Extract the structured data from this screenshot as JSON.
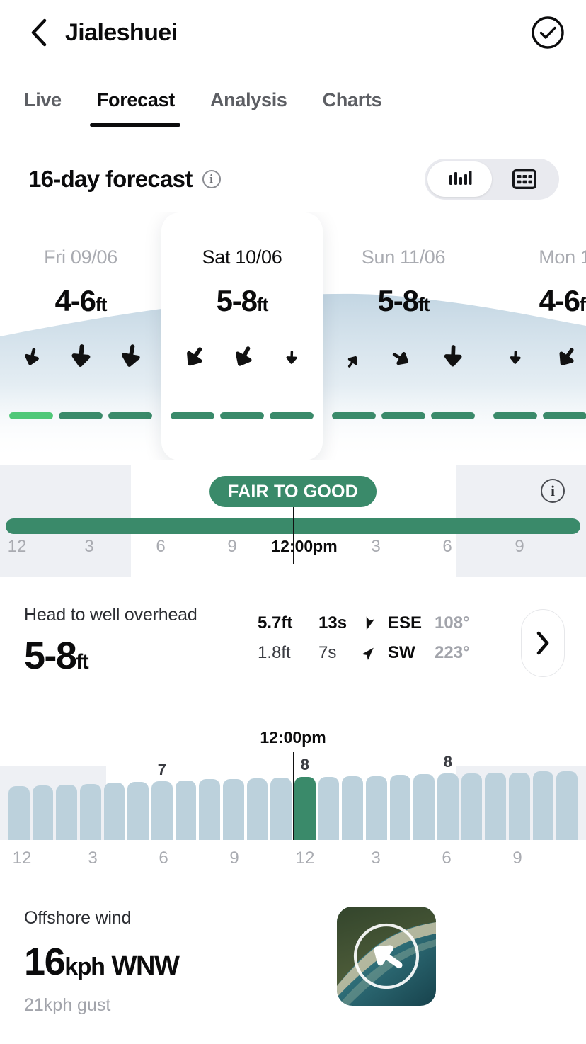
{
  "header": {
    "title": "Jialeshuei",
    "back_icon": "chevron-left-icon",
    "check_icon": "check-circle-icon"
  },
  "tabs": [
    {
      "label": "Live",
      "active": false
    },
    {
      "label": "Forecast",
      "active": true
    },
    {
      "label": "Analysis",
      "active": false
    },
    {
      "label": "Charts",
      "active": false
    }
  ],
  "forecast": {
    "title": "16-day forecast",
    "info_icon": "info-icon",
    "view_toggle": {
      "chart_option_icon": "bar-chart-icon",
      "table_option_icon": "grid-table-icon",
      "selected": "chart"
    }
  },
  "days": [
    {
      "name": "Fri 09/06",
      "height": "4-6",
      "unit": "ft",
      "selected": false,
      "winds": [
        {
          "angle": 105,
          "scale": 0.78
        },
        {
          "angle": 95,
          "scale": 1.0
        },
        {
          "angle": 100,
          "scale": 1.0
        }
      ],
      "ratings": [
        "#4fc878",
        "#3a8a6a",
        "#3a8a6a"
      ]
    },
    {
      "name": "Sat 10/06",
      "height": "5-8",
      "unit": "ft",
      "selected": true,
      "winds": [
        {
          "angle": 125,
          "scale": 0.95
        },
        {
          "angle": 118,
          "scale": 0.95
        },
        {
          "angle": 92,
          "scale": 0.58
        }
      ],
      "ratings": [
        "#3a8a6a",
        "#3a8a6a",
        "#3a8a6a"
      ]
    },
    {
      "name": "Sun 11/06",
      "height": "5-8",
      "unit": "ft",
      "selected": false,
      "winds": [
        {
          "angle": 305,
          "scale": 0.58
        },
        {
          "angle": 30,
          "scale": 0.78
        },
        {
          "angle": 92,
          "scale": 0.95
        }
      ],
      "ratings": [
        "#3a8a6a",
        "#3a8a6a",
        "#3a8a6a"
      ]
    },
    {
      "name": "Mon 1",
      "height": "4-6",
      "unit": "ft",
      "selected": false,
      "winds": [
        {
          "angle": 92,
          "scale": 0.58
        },
        {
          "angle": 125,
          "scale": 0.9
        },
        {
          "angle": 110,
          "scale": 0.8
        }
      ],
      "ratings": [
        "#3a8a6a",
        "#3a8a6a",
        "#3a8a6a"
      ]
    }
  ],
  "rating_timeline": {
    "label": "FAIR TO GOOD",
    "color": "#3a8a6a",
    "info_icon": "info-icon",
    "now_label": "12:00pm",
    "ticks": [
      "12",
      "3",
      "6",
      "9",
      "12:00pm",
      "3",
      "6",
      "9"
    ],
    "now_tick_index": 4
  },
  "swell": {
    "description": "Head to well overhead",
    "size": "5-8",
    "unit": "ft",
    "primary": {
      "height": "5.7ft",
      "period": "13s",
      "direction": "ESE",
      "degrees": "108°",
      "arrow_icon": "swell-direction-arrow-icon",
      "arrow_angle": 198
    },
    "secondary": {
      "height": "1.8ft",
      "period": "7s",
      "direction": "SW",
      "degrees": "223°",
      "arrow_icon": "swell-direction-arrow-icon",
      "arrow_angle": 43
    },
    "expand_icon": "chevron-right-icon"
  },
  "chart_data": {
    "type": "bar",
    "title": "",
    "xlabel": "",
    "ylabel": "",
    "now_label": "12:00pm",
    "now_index": 12,
    "grid": false,
    "legend": false,
    "x": [
      "0",
      "1",
      "2",
      "3",
      "4",
      "5",
      "6",
      "7",
      "8",
      "9",
      "10",
      "11",
      "12",
      "13",
      "14",
      "15",
      "16",
      "17",
      "18",
      "19",
      "20",
      "21",
      "22",
      "23"
    ],
    "values": [
      6.2,
      6.3,
      6.4,
      6.5,
      6.6,
      6.7,
      6.8,
      6.9,
      7.0,
      7.0,
      7.1,
      7.2,
      7.3,
      7.3,
      7.4,
      7.4,
      7.5,
      7.6,
      7.7,
      7.7,
      7.8,
      7.8,
      7.9,
      7.9
    ],
    "ylim": [
      0,
      9
    ],
    "point_labels": [
      {
        "index": 6,
        "text": "7"
      },
      {
        "index": 12,
        "text": "8"
      },
      {
        "index": 18,
        "text": "8"
      }
    ],
    "tick_labels": [
      "12",
      "3",
      "6",
      "9",
      "12",
      "3",
      "6",
      "9"
    ],
    "bar_color": "#bcd1dc",
    "highlight_color": "#3a8a6a",
    "night_color": "#eef0f4"
  },
  "wind": {
    "title": "Offshore wind",
    "speed": "16",
    "speed_unit": "kph",
    "direction": "WNW",
    "gust": "21kph gust",
    "map_icon": "wind-direction-map-thumbnail",
    "map_arrow_angle": 125
  }
}
